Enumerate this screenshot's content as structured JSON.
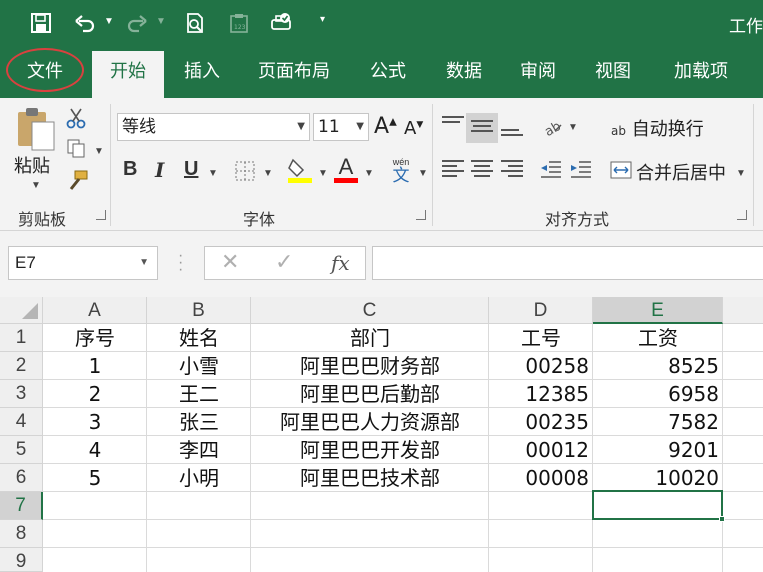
{
  "title_bar": {
    "title": "工作",
    "qat_icons": [
      "save-icon",
      "undo-icon",
      "redo-icon",
      "print-preview-icon",
      "clipboard-disabled-icon",
      "touch-mode-icon",
      "customize-caret-icon"
    ]
  },
  "ribbon_tabs": [
    {
      "label": "文件"
    },
    {
      "label": "开始"
    },
    {
      "label": "插入"
    },
    {
      "label": "页面布局"
    },
    {
      "label": "公式"
    },
    {
      "label": "数据"
    },
    {
      "label": "审阅"
    },
    {
      "label": "视图"
    },
    {
      "label": "加载项"
    }
  ],
  "active_tab": "开始",
  "clipboard_group": {
    "label": "剪贴板",
    "paste_label": "粘贴"
  },
  "font_group": {
    "label": "字体",
    "font_name": "等线",
    "font_size": "11",
    "bold": "B",
    "italic": "I",
    "underline": "U",
    "grow_font": "A",
    "shrink_font": "A",
    "font_color": "A",
    "phonetic": "wén",
    "phonetic_char": "文",
    "highlight_color": "#ffff00",
    "font_color_value": "#ff0000"
  },
  "alignment_group": {
    "label": "对齐方式",
    "wrap_text": "自动换行",
    "merge_center": "合并后居中",
    "wrap_prefix": "ab"
  },
  "formula_bar": {
    "name_box": "E7",
    "formula": "",
    "fx_label": "fx",
    "cancel_glyph": "✕",
    "enter_glyph": "✓"
  },
  "sheet": {
    "columns": [
      "A",
      "B",
      "C",
      "D",
      "E"
    ],
    "selected_column": "E",
    "rows": [
      "1",
      "2",
      "3",
      "4",
      "5",
      "6",
      "7",
      "8",
      "9"
    ],
    "selected_row": "7",
    "selected_cell": "E7",
    "data": [
      [
        "序号",
        "姓名",
        "部门",
        "工号",
        "工资"
      ],
      [
        "1",
        "小雪",
        "阿里巴巴财务部",
        "00258",
        "8525"
      ],
      [
        "2",
        "王二",
        "阿里巴巴后勤部",
        "12385",
        "6958"
      ],
      [
        "3",
        "张三",
        "阿里巴巴人力资源部",
        "00235",
        "7582"
      ],
      [
        "4",
        "李四",
        "阿里巴巴开发部",
        "00012",
        "9201"
      ],
      [
        "5",
        "小明",
        "阿里巴巴技术部",
        "00008",
        "10020"
      ]
    ]
  },
  "accent_color": "#217346",
  "annotation_color": "#d9413f"
}
